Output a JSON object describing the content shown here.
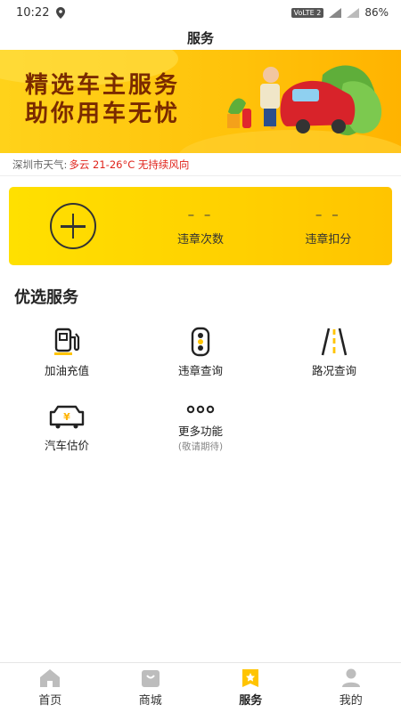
{
  "status_bar": {
    "time": "10:22",
    "network": "VoLTE 2",
    "battery": "86%"
  },
  "header": {
    "title": "服务"
  },
  "banner": {
    "line1": "精选车主服务",
    "line2": "助你用车无忧"
  },
  "weather": {
    "city": "深圳市天气:",
    "forecast": "多云 21-26°C 无持续风向"
  },
  "violation_card": {
    "count_value": "– –",
    "count_label": "违章次数",
    "points_value": "– –",
    "points_label": "违章扣分"
  },
  "section": {
    "title": "优选服务"
  },
  "services": [
    {
      "label": "加油充值",
      "icon": "fuel-pump-icon"
    },
    {
      "label": "违章查询",
      "icon": "traffic-light-icon"
    },
    {
      "label": "路况查询",
      "icon": "road-icon"
    },
    {
      "label": "汽车估价",
      "icon": "car-price-icon"
    },
    {
      "label": "更多功能",
      "sub": "(敬请期待)",
      "icon": "more-dots-icon"
    }
  ],
  "tabs": [
    {
      "label": "首页",
      "icon": "home-icon"
    },
    {
      "label": "商城",
      "icon": "shop-icon"
    },
    {
      "label": "服务",
      "icon": "service-icon",
      "active": true
    },
    {
      "label": "我的",
      "icon": "user-icon"
    }
  ],
  "colors": {
    "accent": "#ffd000",
    "tab_active": "#ffc400",
    "weather_text": "#e0231b"
  }
}
